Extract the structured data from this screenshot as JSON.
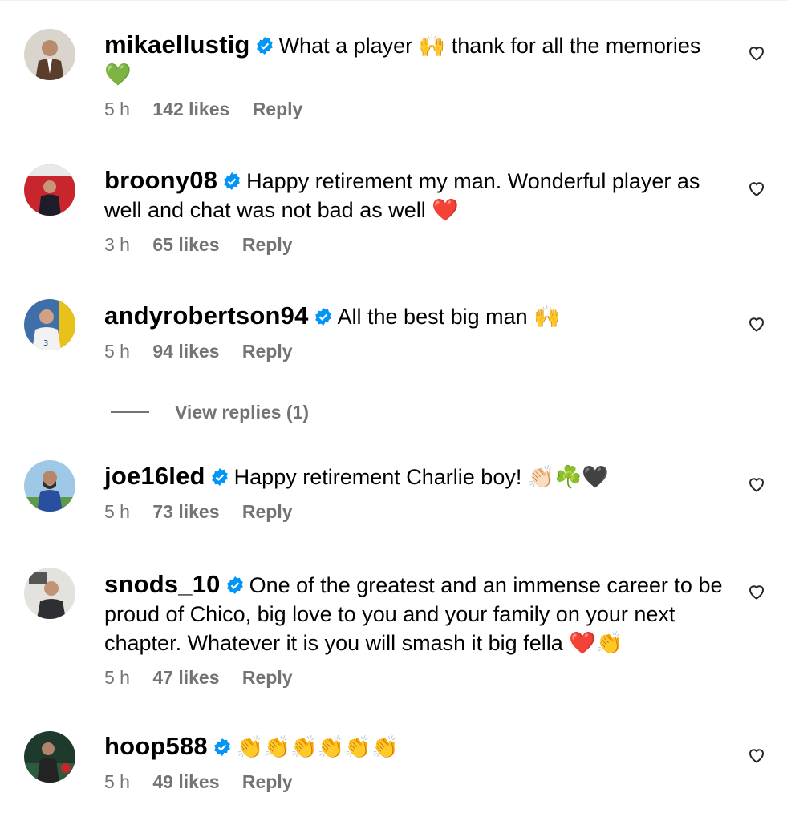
{
  "comments": [
    {
      "username": "mikaellustig",
      "text": "What a player 🙌 thank for all the memories 💚",
      "time": "5 h",
      "likes": "142 likes",
      "reply": "Reply"
    },
    {
      "username": "broony08",
      "text": "Happy retirement my man. Wonderful player as well and chat was not bad as well ❤️",
      "time": "3 h",
      "likes": "65 likes",
      "reply": "Reply"
    },
    {
      "username": "andyrobertson94",
      "text": "All the best big man 🙌",
      "time": "5 h",
      "likes": "94 likes",
      "reply": "Reply"
    },
    {
      "username": "joe16led",
      "text": "Happy retirement Charlie boy! 👏🏻☘️🖤",
      "time": "5 h",
      "likes": "73 likes",
      "reply": "Reply"
    },
    {
      "username": "snods_10",
      "text": "One of the greatest and an immense career to be proud of Chico, big love to you and your family on your next chapter. Whatever it is you will smash it big fella ❤️👏",
      "time": "5 h",
      "likes": "47 likes",
      "reply": "Reply"
    },
    {
      "username": "hoop588",
      "text": "👏👏👏👏👏👏",
      "time": "5 h",
      "likes": "49 likes",
      "reply": "Reply"
    }
  ],
  "view_replies": "View replies (1)",
  "icons": {
    "verified": "verified-badge-icon",
    "like": "heart-outline-icon"
  },
  "colors": {
    "verified": "#0095f6",
    "meta": "#737373"
  }
}
